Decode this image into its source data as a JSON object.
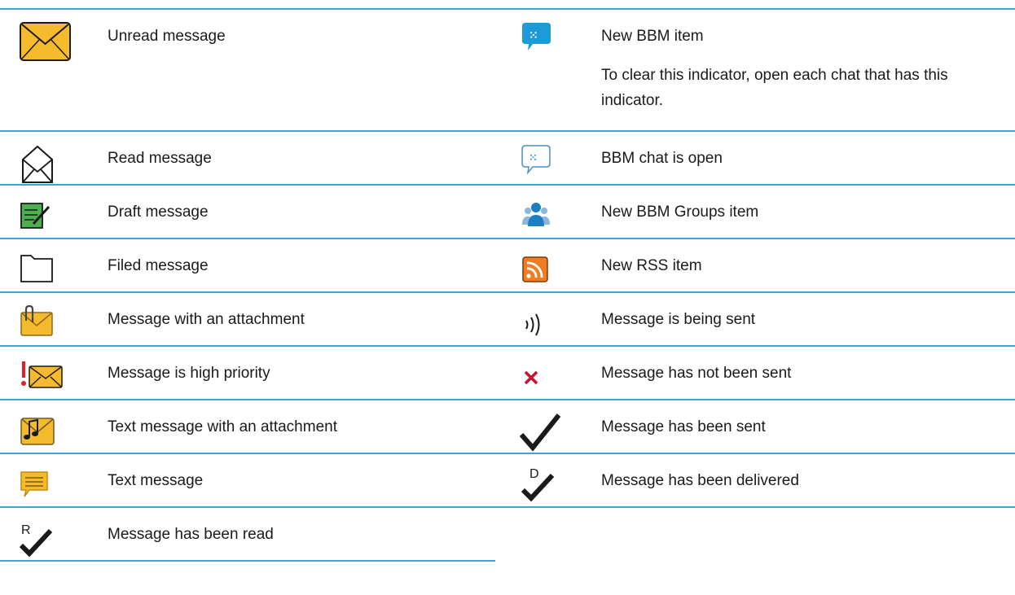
{
  "colors": {
    "rule": "#3aa6d6",
    "envelope_yellow": "#f6bb2d",
    "bbm_blue": "#1d9bd8",
    "error_red": "#c4122f",
    "rss_orange": "#ef7d22"
  },
  "left_items": [
    {
      "icon": "unread-envelope-icon",
      "label": "Unread message"
    },
    {
      "icon": "read-envelope-icon",
      "label": "Read message"
    },
    {
      "icon": "draft-icon",
      "label": "Draft message"
    },
    {
      "icon": "folder-icon",
      "label": "Filed message"
    },
    {
      "icon": "attachment-envelope-icon",
      "label": "Message with an attachment"
    },
    {
      "icon": "high-priority-envelope-icon",
      "label": "Message is high priority"
    },
    {
      "icon": "text-attachment-envelope-icon",
      "label": "Text message with an attachment"
    },
    {
      "icon": "text-message-bubble-icon",
      "label": "Text message"
    },
    {
      "icon": "read-r-check-icon",
      "label": "Message has been read"
    }
  ],
  "right_items": [
    {
      "icon": "bbm-new-item-icon",
      "label": "New BBM item",
      "note": "To clear this indicator, open each chat that has this indicator."
    },
    {
      "icon": "bbm-chat-open-icon",
      "label": "BBM chat is open"
    },
    {
      "icon": "bbm-groups-icon",
      "label": "New BBM Groups item"
    },
    {
      "icon": "rss-icon",
      "label": "New RSS item"
    },
    {
      "icon": "sending-waves-icon",
      "label": "Message is being sent"
    },
    {
      "icon": "not-sent-x-icon",
      "label": "Message has not been sent"
    },
    {
      "icon": "sent-check-icon",
      "label": "Message has been sent"
    },
    {
      "icon": "delivered-d-check-icon",
      "label": "Message has been delivered"
    }
  ]
}
